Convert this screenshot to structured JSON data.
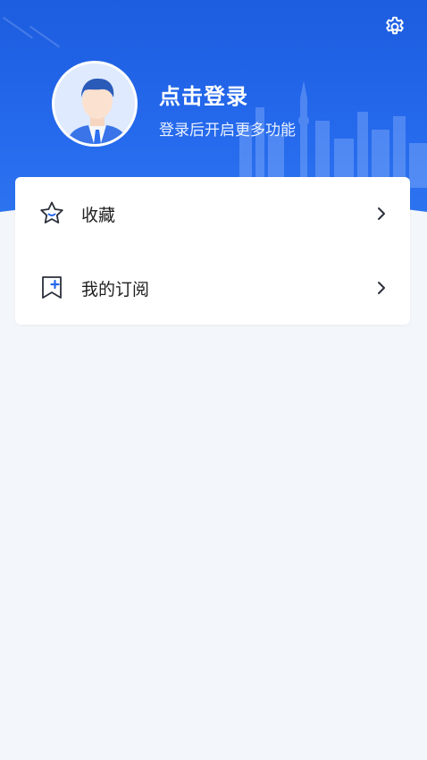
{
  "header": {
    "login_title": "点击登录",
    "login_subtitle": "登录后开启更多功能",
    "settings_icon": "gear-icon",
    "avatar_icon": "default-male-avatar"
  },
  "menu": {
    "items": [
      {
        "label": "收藏",
        "icon": "star-icon"
      },
      {
        "label": "我的订阅",
        "icon": "subscribe-bookmark-plus-icon"
      }
    ],
    "chevron_icon": "chevron-right-icon"
  },
  "colors": {
    "header_blue": "#1d5ddf",
    "page_bg": "#f3f6fa",
    "card_bg": "#ffffff",
    "accent": "#2468ec"
  }
}
